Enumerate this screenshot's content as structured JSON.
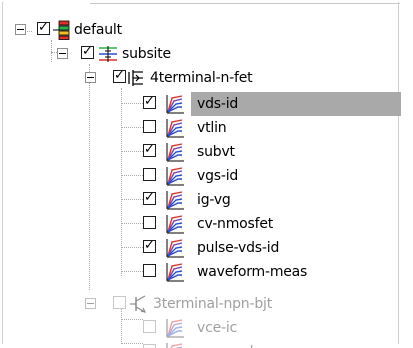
{
  "tree": {
    "nodes": [
      {
        "label": "default",
        "checked": true,
        "icon": "tree-hierarchy-icon"
      },
      {
        "label": "subsite",
        "checked": true,
        "icon": "probe-circuit-icon"
      },
      {
        "label": "4terminal-n-fet",
        "checked": true,
        "icon": "nfet-transistor-icon"
      },
      {
        "label": "vds-id",
        "checked": true,
        "selected": true,
        "icon": "graph-curves-icon"
      },
      {
        "label": "vtlin",
        "checked": false,
        "icon": "graph-curves-icon"
      },
      {
        "label": "subvt",
        "checked": true,
        "icon": "graph-curves-icon"
      },
      {
        "label": "vgs-id",
        "checked": false,
        "icon": "graph-curves-icon"
      },
      {
        "label": "ig-vg",
        "checked": true,
        "icon": "graph-curves-icon"
      },
      {
        "label": "cv-nmosfet",
        "checked": false,
        "icon": "graph-curves-icon"
      },
      {
        "label": "pulse-vds-id",
        "checked": true,
        "icon": "graph-curves-icon"
      },
      {
        "label": "waveform-meas",
        "checked": false,
        "icon": "graph-curves-icon"
      },
      {
        "label": "3terminal-npn-bjt",
        "checked": false,
        "disabled": true,
        "icon": "bjt-transistor-icon"
      },
      {
        "label": "vce-ic",
        "checked": false,
        "disabled": true,
        "icon": "graph-curves-icon"
      },
      {
        "label": "gummel",
        "checked": false,
        "disabled": true,
        "icon": "graph-curves-icon"
      }
    ]
  },
  "colors": {
    "selection": "#a9a9a9",
    "disabled_text": "#a0a0a0",
    "curve_red": "#e0302a",
    "curve_blue": "#2a4fd6",
    "curve_purple": "#7a3fb0"
  }
}
